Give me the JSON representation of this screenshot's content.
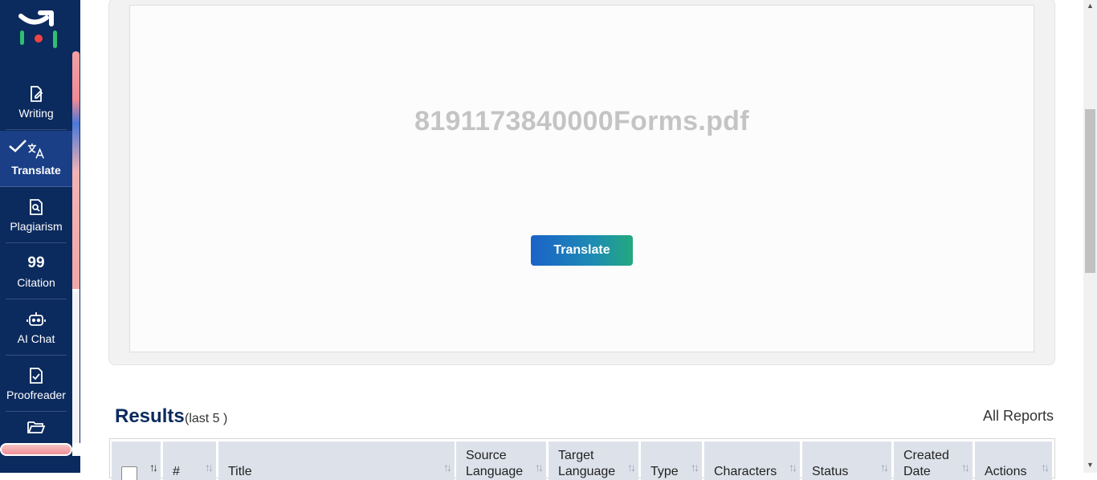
{
  "sidebar": {
    "items": [
      {
        "label": "Writing",
        "icon": "document-edit-icon"
      },
      {
        "label": "Translate",
        "icon": "translate-icon",
        "active": true
      },
      {
        "label": "Plagiarism",
        "icon": "document-search-icon"
      },
      {
        "label": "Citation",
        "icon": "quote-icon",
        "glyph": "99"
      },
      {
        "label": "AI Chat",
        "icon": "robot-icon"
      },
      {
        "label": "Proofreader",
        "icon": "document-check-icon"
      },
      {
        "label": "",
        "icon": "folder-icon"
      }
    ]
  },
  "upload": {
    "file_name": "8191173840000Forms.pdf",
    "translate_button": "Translate"
  },
  "results": {
    "title": "Results",
    "subtitle": "(last 5 )",
    "all_reports": "All Reports",
    "columns": [
      "#",
      "Title",
      "Source Language",
      "Target Language",
      "Type",
      "Characters",
      "Status",
      "Created Date",
      "Actions"
    ]
  },
  "colors": {
    "sidebar": "#0b2a5e",
    "accent": "#1b62c9",
    "accent_end": "#23a97f"
  }
}
